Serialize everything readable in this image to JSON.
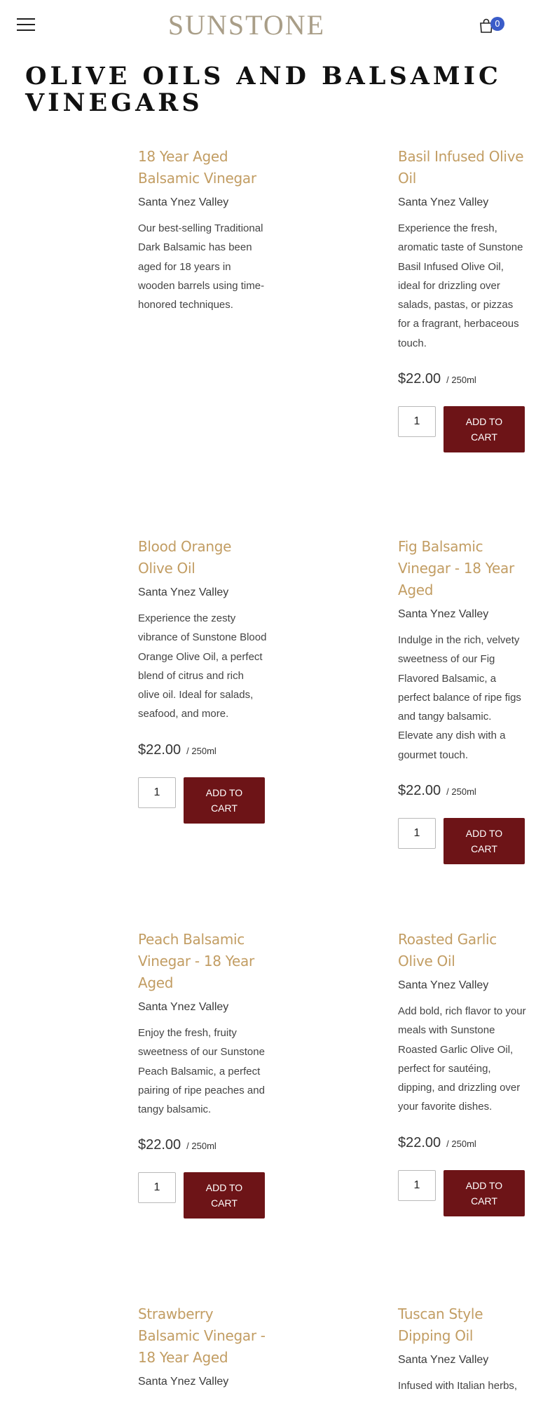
{
  "header": {
    "logo_text": "SUNSTONE",
    "cart_count": "0"
  },
  "page": {
    "title": "Olive Oils and Balsamic Vinegars"
  },
  "products": [
    {
      "name": "18 Year Aged Balsamic Vinegar",
      "origin": "Santa Ynez Valley",
      "description": "Our best-selling Traditional Dark Balsamic has been aged for 18 years in wooden barrels using time-honored techniques."
    },
    {
      "name": "Basil Infused Olive Oil",
      "origin": "Santa Ynez Valley",
      "description": "Experience the fresh, aromatic taste of Sunstone Basil Infused Olive Oil, ideal for drizzling over salads, pastas, or pizzas for a fragrant, herbaceous touch.",
      "price": "$22.00",
      "unit": "/ 250ml",
      "quantity": "1",
      "button_label": "ADD TO CART"
    },
    {
      "name": "Blood Orange Olive Oil",
      "origin": "Santa Ynez Valley",
      "description": "Experience the zesty vibrance of Sunstone Blood Orange Olive Oil, a perfect blend of citrus and rich olive oil. Ideal for salads, seafood, and more.",
      "price": "$22.00",
      "unit": "/ 250ml",
      "quantity": "1",
      "button_label": "ADD TO CART"
    },
    {
      "name": "Fig Balsamic Vinegar - 18 Year Aged",
      "origin": "Santa Ynez Valley",
      "description": "Indulge in the rich, velvety sweetness of our Fig Flavored Balsamic, a perfect balance of ripe figs and tangy balsamic. Elevate any dish with a gourmet touch.",
      "price": "$22.00",
      "unit": "/ 250ml",
      "quantity": "1",
      "button_label": "ADD TO CART"
    },
    {
      "name": "Peach Balsamic Vinegar - 18 Year Aged",
      "origin": "Santa Ynez Valley",
      "description": "Enjoy the fresh, fruity sweetness of our Sunstone Peach Balsamic, a perfect pairing of ripe peaches and tangy balsamic.",
      "price": "$22.00",
      "unit": "/ 250ml",
      "quantity": "1",
      "button_label": "ADD TO CART"
    },
    {
      "name": "Roasted Garlic Olive Oil",
      "origin": "Santa Ynez Valley",
      "description": "Add bold, rich flavor to your meals with Sunstone Roasted Garlic Olive Oil, perfect for sautéing, dipping, and drizzling over your favorite dishes.",
      "price": "$22.00",
      "unit": "/ 250ml",
      "quantity": "1",
      "button_label": "ADD TO CART"
    },
    {
      "name": "Strawberry Balsamic Vinegar - 18 Year Aged",
      "origin": "Santa Ynez Valley"
    },
    {
      "name": "Tuscan Style Dipping Oil",
      "origin": "Santa Ynez Valley",
      "description": "Infused with Italian herbs,"
    }
  ],
  "colors": {
    "product_name": "#c29d63",
    "button_bg": "#6d1417",
    "cart_badge": "#3a5cc9",
    "logo": "#a99e88"
  },
  "icons": {
    "menu": "hamburger-menu-icon",
    "cart": "shopping-bag-icon"
  }
}
